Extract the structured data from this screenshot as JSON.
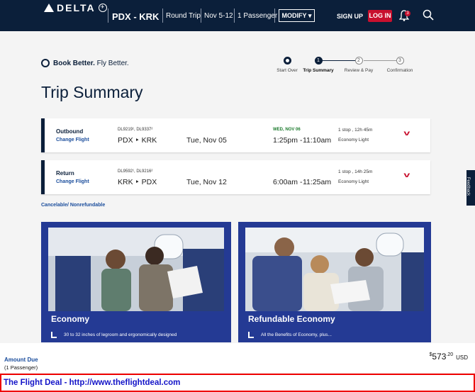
{
  "header": {
    "logo": "DELTA",
    "route": "PDX - KRK",
    "trip_type": "Round Trip",
    "dates": "Nov 5-12",
    "passengers": "1 Passenger",
    "modify_label": "MODIFY",
    "signup_label": "SIGN UP",
    "login_label": "LOG IN",
    "notification_count": "3"
  },
  "tagline": {
    "bold": "Book Better.",
    "rest": " Fly Better."
  },
  "steps": [
    {
      "label": "Start Over"
    },
    {
      "num": "1",
      "label": "Trip Summary"
    },
    {
      "num": "2",
      "label": "Review & Pay"
    },
    {
      "num": "3",
      "label": "Confirmation"
    }
  ],
  "page_title": "Trip Summary",
  "flights": [
    {
      "direction": "Outbound",
      "change": "Change Flight",
      "flight_numbers": "DL9219¹, DL9337²",
      "route": "PDX ‣ KRK",
      "date": "Tue, Nov 05",
      "day_note": "WED, NOV 06",
      "time_depart": "1:25pm -",
      "time_arrive": "11:10am",
      "stops": "1 stop , 12h 45m",
      "cabin": "Economy Light"
    },
    {
      "direction": "Return",
      "change": "Change Flight",
      "flight_numbers": "DL9592¹, DL9216²",
      "route": "KRK ‣ PDX",
      "date": "Tue, Nov 12",
      "day_note": "",
      "time_depart": "6:00am -",
      "time_arrive": "11:25am",
      "stops": "1 stop , 14h 25m",
      "cabin": "Economy Light"
    }
  ],
  "cancel_note": "Cancelable/ Nonrefundable",
  "fares": [
    {
      "name": "Economy",
      "feature": "30 to 32 inches of legroom and ergonomically designed"
    },
    {
      "name": "Refundable Economy",
      "feature": "All the Benefits of Economy, plus..."
    }
  ],
  "feedback_label": "Feedback",
  "amount": {
    "label": "Amount Due",
    "pax": "(1 Passenger)",
    "currency_symbol": "$",
    "whole": "573",
    "cents": ".20",
    "currency": "USD"
  },
  "flightdeal_banner": "The Flight Deal - http://www.theflightdeal.com",
  "colors": {
    "navy": "#0b1f3a",
    "red": "#c8102e",
    "fare_blue": "#243a94",
    "link_blue": "#1a4d9c"
  }
}
